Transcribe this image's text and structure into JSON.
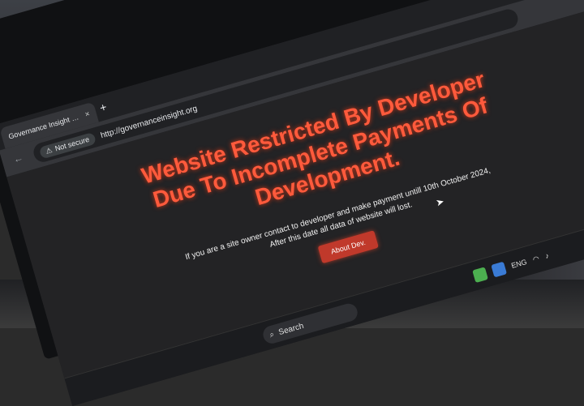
{
  "browser": {
    "tab_title": "Governance Insight Foundation",
    "tab_close": "×",
    "new_tab": "+",
    "security_badge": "Not secure",
    "url": "http://governanceinsight.org"
  },
  "page": {
    "headline_line1": "Website Restricted By Developer",
    "headline_line2": "Due To Incomplete Payments Of",
    "headline_line3": "Development.",
    "message_line1": "If you are a site owner contact to developer and make payment untill 10th October 2024,",
    "message_line2": "After this date all data of website will lost.",
    "about_button": "About Dev."
  },
  "taskbar": {
    "search_label": "Search",
    "language": "ENG"
  },
  "colors": {
    "headline": "#ff5a3c",
    "button": "#c0392b",
    "page_bg": "#232325"
  }
}
